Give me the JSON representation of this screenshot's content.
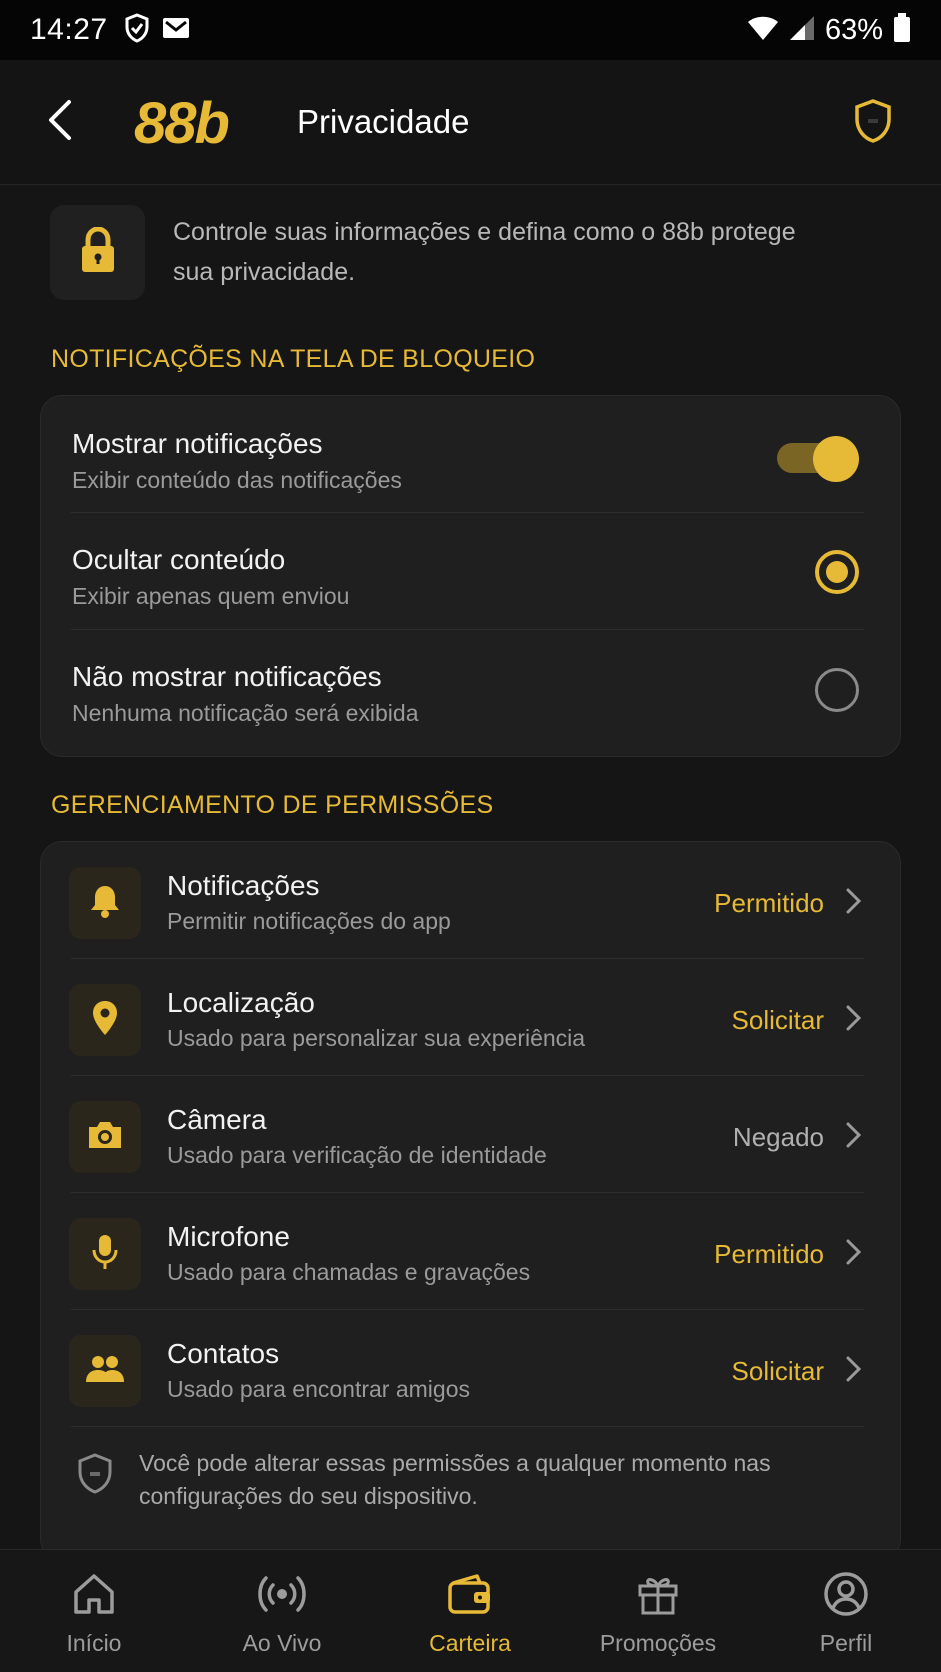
{
  "status_bar": {
    "time": "14:27",
    "battery": "63%",
    "icons": [
      "shield-check-icon",
      "mail-icon",
      "wifi-icon",
      "signal-icon",
      "battery-icon"
    ]
  },
  "app_bar": {
    "brand": "88b",
    "title": "Privacidade",
    "icons": [
      "back-arrow-icon",
      "shield-icon"
    ]
  },
  "intro": {
    "text": "Controle suas informações e defina como o 88b protege sua privacidade.",
    "icon": "lock-icon"
  },
  "lockscreen_section": {
    "title": "NOTIFICAÇÕES NA TELA DE BLOQUEIO",
    "options": [
      {
        "title": "Mostrar notificações",
        "subtitle": "Exibir conteúdo das notificações",
        "control": "toggle",
        "state": "on"
      },
      {
        "title": "Ocultar conteúdo",
        "subtitle": "Exibir apenas quem enviou",
        "control": "radio",
        "state": "selected"
      },
      {
        "title": "Não mostrar notificações",
        "subtitle": "Nenhuma notificação será exibida",
        "control": "radio",
        "state": "unselected"
      }
    ]
  },
  "permissions_section": {
    "title": "GERENCIAMENTO DE PERMISSÕES",
    "items": [
      {
        "title": "Notificações",
        "subtitle": "Permitir notificações do app",
        "status": "Permitido",
        "icon": "bell-icon"
      },
      {
        "title": "Localização",
        "subtitle": "Usado para personalizar sua experiência",
        "status": "Solicitar",
        "icon": "location-pin-icon"
      },
      {
        "title": "Câmera",
        "subtitle": "Usado para verificação de identidade",
        "status": "Negado",
        "icon": "camera-icon"
      },
      {
        "title": "Microfone",
        "subtitle": "Usado para chamadas e gravações",
        "status": "Permitido",
        "icon": "microphone-icon"
      },
      {
        "title": "Contatos",
        "subtitle": "Usado para encontrar amigos",
        "status": "Solicitar",
        "icon": "contacts-icon"
      }
    ],
    "footnote": "Você pode alterar essas permissões a qualquer momento nas configurações do seu dispositivo."
  },
  "bottom_nav": {
    "items": [
      {
        "label": "Início",
        "icon": "home-icon"
      },
      {
        "label": "Ao Vivo",
        "icon": "live-broadcast-icon"
      },
      {
        "label": "Carteira",
        "icon": "wallet-icon",
        "active": true
      },
      {
        "label": "Promoções",
        "icon": "gift-icon"
      },
      {
        "label": "Perfil",
        "icon": "profile-icon"
      }
    ]
  },
  "colors": {
    "accent": "#e6b936",
    "background": "#151515",
    "card": "#1f1f1f",
    "status_denied": "#b0b0b0"
  }
}
